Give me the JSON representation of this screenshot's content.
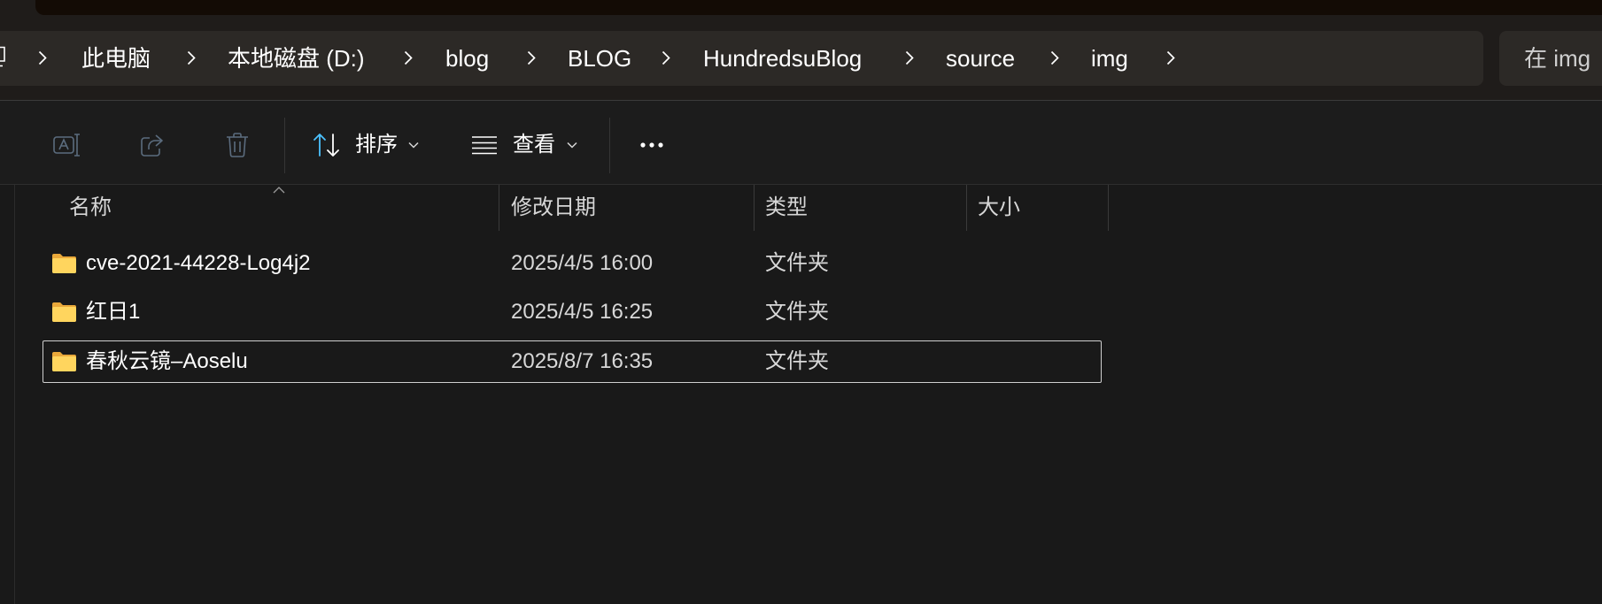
{
  "colors": {
    "header_bg": "#1f1c1a",
    "address_bg": "#2c2926",
    "toolbar_bg": "#1c1c1c",
    "list_bg": "#191919",
    "text": "#ffffff",
    "muted_text": "#d8d8d8",
    "disabled_icon": "#5b6c7e",
    "accent": "#4cc2ff",
    "folder_front": "#ffd55e",
    "folder_back": "#e9a83a",
    "focus_border": "#cfcfcf",
    "divider": "#3a3a3a"
  },
  "address_bar": {
    "leading_icon": "pc-icon",
    "separator_icon": "chevron-right-icon",
    "segments": [
      "此电脑",
      "本地磁盘 (D:)",
      "blog",
      "BLOG",
      "HundredsuBlog",
      "source",
      "img"
    ]
  },
  "search": {
    "placeholder": "在 img"
  },
  "command_bar": {
    "rename": {
      "icon": "rename-icon",
      "enabled": false
    },
    "share": {
      "icon": "share-icon",
      "enabled": false
    },
    "delete": {
      "icon": "delete-icon",
      "enabled": false
    },
    "sort": {
      "icon": "sort-icon",
      "label": "排序",
      "dropdown_icon": "chevron-down-icon"
    },
    "view": {
      "icon": "view-icon",
      "label": "查看",
      "dropdown_icon": "chevron-down-icon"
    },
    "more": {
      "icon": "more-icon"
    }
  },
  "file_list": {
    "columns": [
      "名称",
      "修改日期",
      "类型",
      "大小"
    ],
    "sort_column_index": 0,
    "sort_direction": "ascending",
    "focused_row": 2,
    "rows": [
      {
        "icon": "folder-icon",
        "name": "cve-2021-44228-Log4j2",
        "modified": "2025/4/5 16:00",
        "type": "文件夹"
      },
      {
        "icon": "folder-icon",
        "name": "红日1",
        "modified": "2025/4/5 16:25",
        "type": "文件夹"
      },
      {
        "icon": "folder-icon",
        "name": "春秋云镜–Aoselu",
        "modified": "2025/8/7 16:35",
        "type": "文件夹"
      }
    ]
  }
}
